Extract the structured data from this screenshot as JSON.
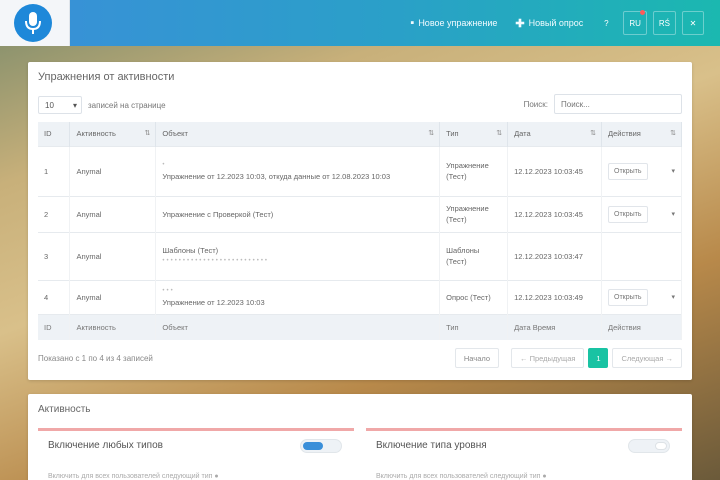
{
  "header": {
    "nav": [
      {
        "icon": "plus-icon",
        "label": "Новое упражнение"
      },
      {
        "icon": "plus-icon",
        "label": "Новый опрос"
      }
    ],
    "buttons": [
      "?",
      "RU",
      "RŚ",
      "✕"
    ]
  },
  "main": {
    "title": "Упражнения от активности",
    "length_value": "10",
    "length_label": "записей на странице",
    "filter_label": "Поиск:",
    "filter_placeholder": "Поиск...",
    "columns": [
      "ID",
      "Активность",
      "Объект",
      "Тип",
      "Дата",
      "Действия"
    ],
    "rows": [
      {
        "id": "1",
        "activity": "Anymal",
        "object": "Упражнение от 12.2023 10:03, откуда данные от 12.08.2023 10:03",
        "type": "Упражнение (Тест)",
        "date": "12.12.2023 10:03:45",
        "action": "Открыть"
      },
      {
        "id": "2",
        "activity": "Anymal",
        "object": "Упражнение с Проверкой (Тест)",
        "type": "Упражнение (Тест)",
        "date": "12.12.2023 10:03:45",
        "action": "Открыть"
      },
      {
        "id": "3",
        "activity": "Anymal",
        "object": "Шаблоны (Тест)",
        "type": "Шаблоны (Тест)",
        "date": "12.12.2023 10:03:47",
        "action": ""
      },
      {
        "id": "4",
        "activity": "Anymal",
        "object": "Упражнение от 12.2023 10:03",
        "type": "Опрос (Тест)",
        "date": "12.12.2023 10:03:49",
        "action": "Открыть"
      }
    ],
    "footer": [
      "ID",
      "Активность",
      "Объект",
      "Тип",
      "Дата Время",
      "Действия"
    ],
    "info": "Показано с 1 по 4 из 4 записей",
    "pager": {
      "first": "Начало",
      "prev": "← Предыдущая",
      "current": "1",
      "next": "Следующая →"
    }
  },
  "panels": {
    "title": "Активность",
    "left": {
      "title": "Включение любых типов",
      "text": "Включить для всех пользователей следующий тип ●"
    },
    "right": {
      "title": "Включение типа уровня",
      "text": "Включить для всех пользователей следующий тип ●"
    }
  }
}
